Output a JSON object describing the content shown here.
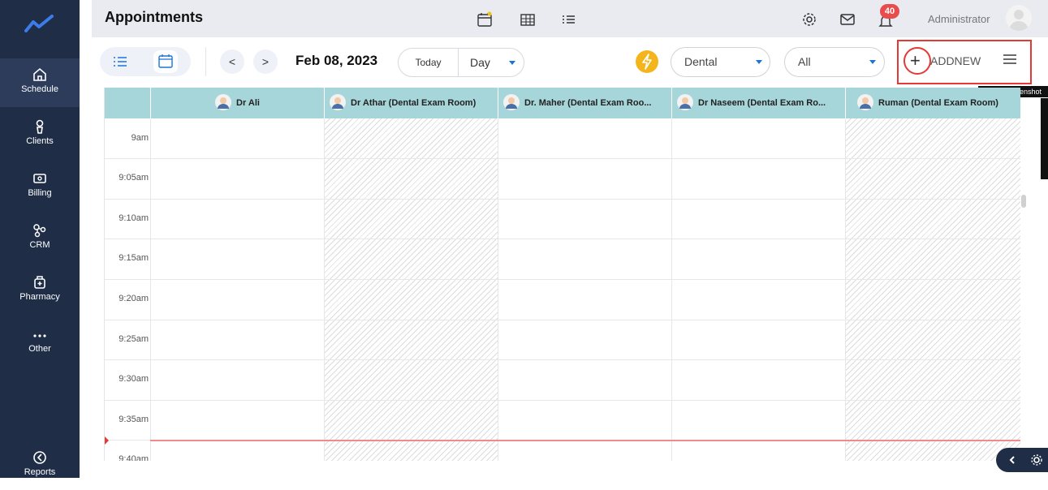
{
  "sidebar": {
    "items": [
      {
        "label": "Schedule",
        "icon": "home-icon"
      },
      {
        "label": "Clients",
        "icon": "user-icon"
      },
      {
        "label": "Billing",
        "icon": "money-icon"
      },
      {
        "label": "CRM",
        "icon": "crm-icon"
      },
      {
        "label": "Pharmacy",
        "icon": "pharmacy-icon"
      },
      {
        "label": "Other",
        "icon": "more-icon"
      },
      {
        "label": "Reports",
        "icon": "reports-icon"
      }
    ]
  },
  "header": {
    "title": "Appointments",
    "notifications_count": "40",
    "user_name": "Administrator"
  },
  "toolbar": {
    "date": "Feb 08, 2023",
    "today_label": "Today",
    "view_select": "Day",
    "department_select": "Dental",
    "filter_select": "All",
    "add_label": "ADDNEW",
    "prev_label": "<",
    "next_label": ">"
  },
  "tooltip": "Take a screenshot",
  "calendar": {
    "columns": [
      "Dr Ali",
      "Dr Athar (Dental Exam Room)",
      "Dr. Maher (Dental Exam Roo...",
      "Dr Naseem (Dental Exam Ro...",
      "Ruman (Dental Exam Room)"
    ],
    "times": [
      "9am",
      "9:05am",
      "9:10am",
      "9:15am",
      "9:20am",
      "9:25am",
      "9:30am",
      "9:35am",
      "9:40am"
    ]
  },
  "colors": {
    "sidebar_bg": "#1f2d47",
    "header_bg": "#e9ebf1",
    "column_header_bg": "#a6d6d9",
    "accent": "#1b74d8",
    "highlight": "#e53935"
  }
}
